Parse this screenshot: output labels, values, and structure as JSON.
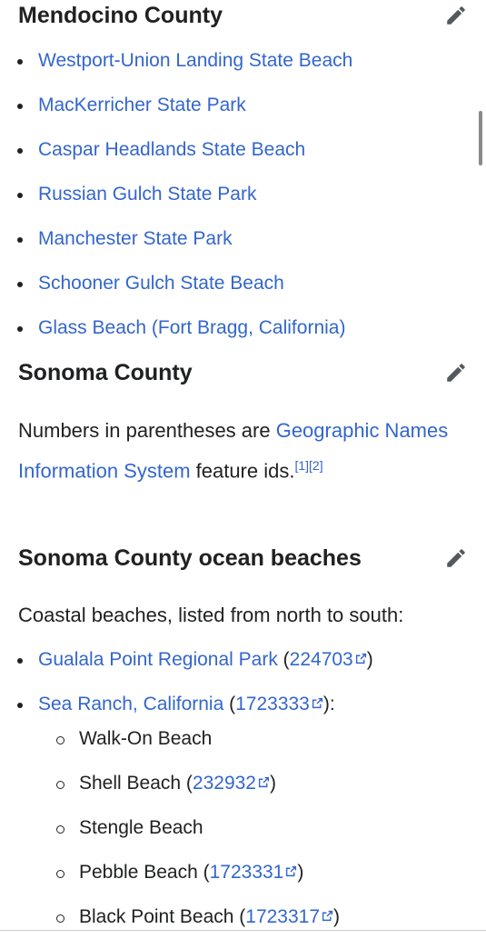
{
  "mendocino": {
    "heading": "Mendocino County",
    "items": [
      "Westport-Union Landing State Beach",
      "MacKerricher State Park",
      "Caspar Headlands State Beach",
      "Russian Gulch State Park",
      "Manchester State Park",
      "Schooner Gulch State Beach",
      "Glass Beach (Fort Bragg, California)"
    ]
  },
  "sonoma": {
    "heading": "Sonoma County",
    "para_prefix": "Numbers in parentheses are ",
    "para_link": "Geographic Names Information System",
    "para_suffix": " feature ids.",
    "ref1": "[1]",
    "ref2": "[2]"
  },
  "sonoma_beaches": {
    "heading": "Sonoma County ocean beaches",
    "intro": "Coastal beaches, listed from north to south:",
    "gualala": {
      "name": "Gualala Point Regional Park",
      "id": "224703"
    },
    "sea_ranch": {
      "name": "Sea Ranch, California",
      "id": "1723333"
    },
    "sub_items": [
      {
        "name": "Walk-On Beach"
      },
      {
        "name": "Shell Beach",
        "id": "232932"
      },
      {
        "name": "Stengle Beach"
      },
      {
        "name": "Pebble Beach",
        "id": "1723331"
      },
      {
        "name": "Black Point Beach",
        "id": "1723317"
      }
    ]
  },
  "icons": {
    "edit": "pencil-icon",
    "external": "external-link-icon"
  },
  "colors": {
    "link": "#3366cc",
    "text": "#202122"
  }
}
